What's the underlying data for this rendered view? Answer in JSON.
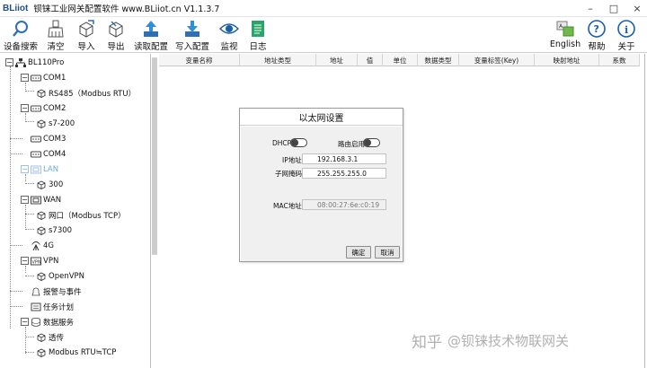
{
  "window": {
    "logo": "BLiiot",
    "title": "钡铼工业网关配置软件 www.BLiiot.cn V1.1.3.7",
    "controls": [
      "–",
      "□",
      "×"
    ]
  },
  "toolbar": {
    "left": [
      {
        "id": "search-device",
        "label": "设备搜索",
        "icon": "search-icon"
      },
      {
        "id": "clear",
        "label": "清空",
        "icon": "broom-icon"
      },
      {
        "id": "import",
        "label": "导入",
        "icon": "box-import-icon"
      },
      {
        "id": "export",
        "label": "导出",
        "icon": "box-export-icon"
      },
      {
        "id": "read-config",
        "label": "读取配置",
        "icon": "upload-arrow-icon"
      },
      {
        "id": "write-config",
        "label": "写入配置",
        "icon": "download-arrow-icon"
      },
      {
        "id": "monitor",
        "label": "监视",
        "icon": "eye-icon"
      },
      {
        "id": "log",
        "label": "日志",
        "icon": "document-icon"
      }
    ],
    "right": [
      {
        "id": "language",
        "label": "English",
        "icon": "language-icon"
      },
      {
        "id": "help",
        "label": "帮助",
        "icon": "help-icon"
      },
      {
        "id": "about",
        "label": "关于",
        "icon": "info-icon"
      }
    ]
  },
  "tree": {
    "root": "BL110Pro",
    "com1": "COM1",
    "com1_child": "RS485（Modbus RTU）",
    "com2": "COM2",
    "com2_child": "s7-200",
    "com3": "COM3",
    "com4": "COM4",
    "lan": "LAN",
    "lan_child": "300",
    "wan": "WAN",
    "wan_child1": "网口（Modbus TCP）",
    "wan_child2": "s7300",
    "g4": "4G",
    "vpn": "VPN",
    "vpn_child": "OpenVPN",
    "alarm": "报警与事件",
    "task": "任务计划",
    "data_service": "数据服务",
    "ds_child1": "透传",
    "ds_child2": "Modbus RTU≒TCP"
  },
  "grid": {
    "columns": [
      "变量名称",
      "地址类型",
      "地址",
      "值",
      "单位",
      "数据类型",
      "变量标签(Key)",
      "映射地址",
      "系数"
    ]
  },
  "dialog": {
    "title": "以太网设置",
    "dhcp_label": "DHCP",
    "router_label": "路由启用",
    "ip_label": "IP地址",
    "ip_value": "192.168.3.1",
    "mask_label": "子网掩码",
    "mask_value": "255.255.255.0",
    "mac_label": "MAC地址",
    "mac_value": "08:00:27:6e:c0:19",
    "ok": "确定",
    "cancel": "取消"
  },
  "watermark": {
    "site": "知乎",
    "author": "@钡铼技术物联网关"
  },
  "colors": {
    "accent": "#1f4e8c",
    "disabled_text": "#6fa9d8",
    "dialog_bg": "#f0f0f0"
  }
}
